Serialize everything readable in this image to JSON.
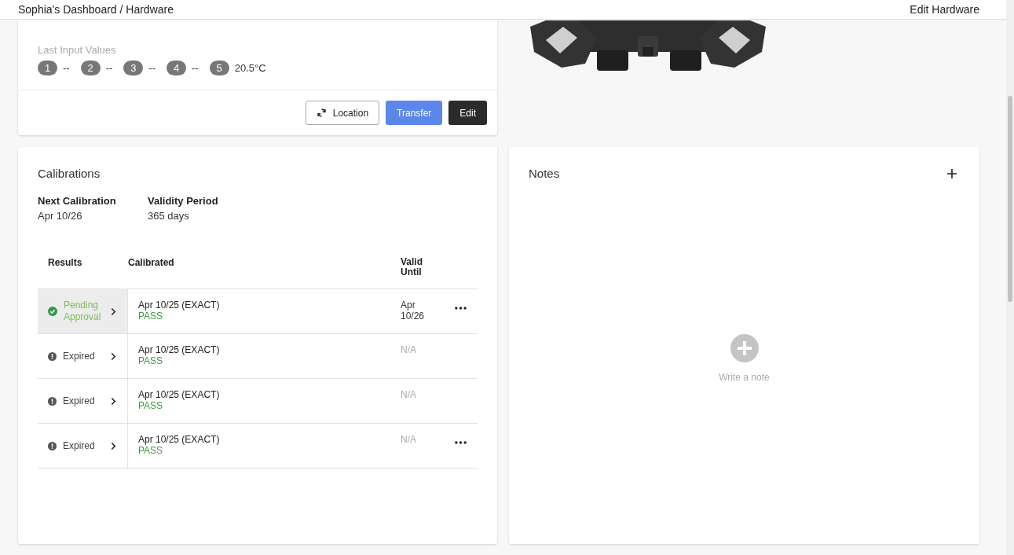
{
  "breadcrumb": "Sophia's Dashboard / Hardware",
  "header_action": "Edit Hardware",
  "device": {
    "last_input_values": {
      "label": "Last Input Values",
      "inputs": [
        {
          "number": "1",
          "value": "--"
        },
        {
          "number": "2",
          "value": "--"
        },
        {
          "number": "3",
          "value": "--"
        },
        {
          "number": "4",
          "value": "--"
        },
        {
          "number": "5",
          "value": "20.5°C"
        }
      ]
    },
    "buttons": [
      {
        "label": "Location",
        "kind": "outline"
      },
      {
        "label": "Transfer",
        "kind": "primary"
      },
      {
        "label": "Edit",
        "kind": "dark"
      }
    ]
  },
  "calibrations": {
    "title": "Calibrations",
    "summary": [
      {
        "label": "Next Calibration",
        "value": "Apr 10/26"
      },
      {
        "label": "Validity Period",
        "value": "365 days"
      }
    ],
    "columns": [
      "Results",
      "Calibrated",
      "Valid Until"
    ],
    "rows": [
      {
        "status": "Pending Approval",
        "kind": "pending",
        "selected": true,
        "calibrated": "Apr 10/25 (EXACT)",
        "result": "PASS",
        "valid_until": "Apr 10/26",
        "has_menu": true
      },
      {
        "status": "Expired",
        "kind": "expired",
        "selected": false,
        "calibrated": "Apr 10/25 (EXACT)",
        "result": "PASS",
        "valid_until": "N/A",
        "has_menu": false
      },
      {
        "status": "Expired",
        "kind": "expired",
        "selected": false,
        "calibrated": "Apr 10/25 (EXACT)",
        "result": "PASS",
        "valid_until": "N/A",
        "has_menu": false
      },
      {
        "status": "Expired",
        "kind": "expired",
        "selected": false,
        "calibrated": "Apr 10/25 (EXACT)",
        "result": "PASS",
        "valid_until": "N/A",
        "has_menu": true
      }
    ]
  },
  "notes": {
    "title": "Notes",
    "empty_text": "Write a note"
  }
}
